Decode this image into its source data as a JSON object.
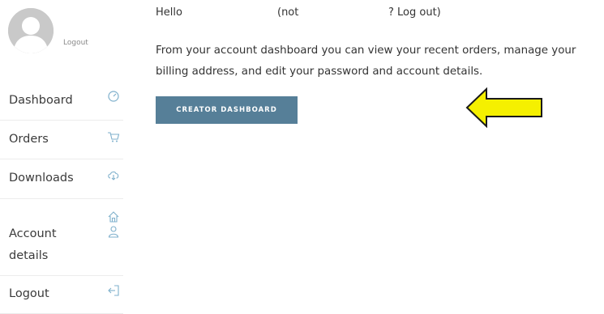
{
  "sidebar": {
    "avatar_logout": "Logout",
    "items": [
      {
        "label": "Dashboard",
        "icon": "dashboard-gauge-icon"
      },
      {
        "label": "Orders",
        "icon": "cart-icon"
      },
      {
        "label": "Downloads",
        "icon": "cloud-download-icon"
      },
      {
        "label": "Account details",
        "icon": "user-icon"
      },
      {
        "label": "Logout",
        "icon": "logout-icon"
      }
    ]
  },
  "main": {
    "greeting": {
      "hello": "Hello",
      "not": "(not",
      "logout_link": "? Log out)"
    },
    "description": "From your account dashboard you can view your recent orders, manage your billing address, and edit your password and account details.",
    "button_label": "CREATOR DASHBOARD"
  },
  "colors": {
    "button_bg": "#567f98",
    "icon_accent": "#7fb0cc",
    "arrow_fill": "#f5f000",
    "avatar_bg": "#c9c9c9"
  }
}
